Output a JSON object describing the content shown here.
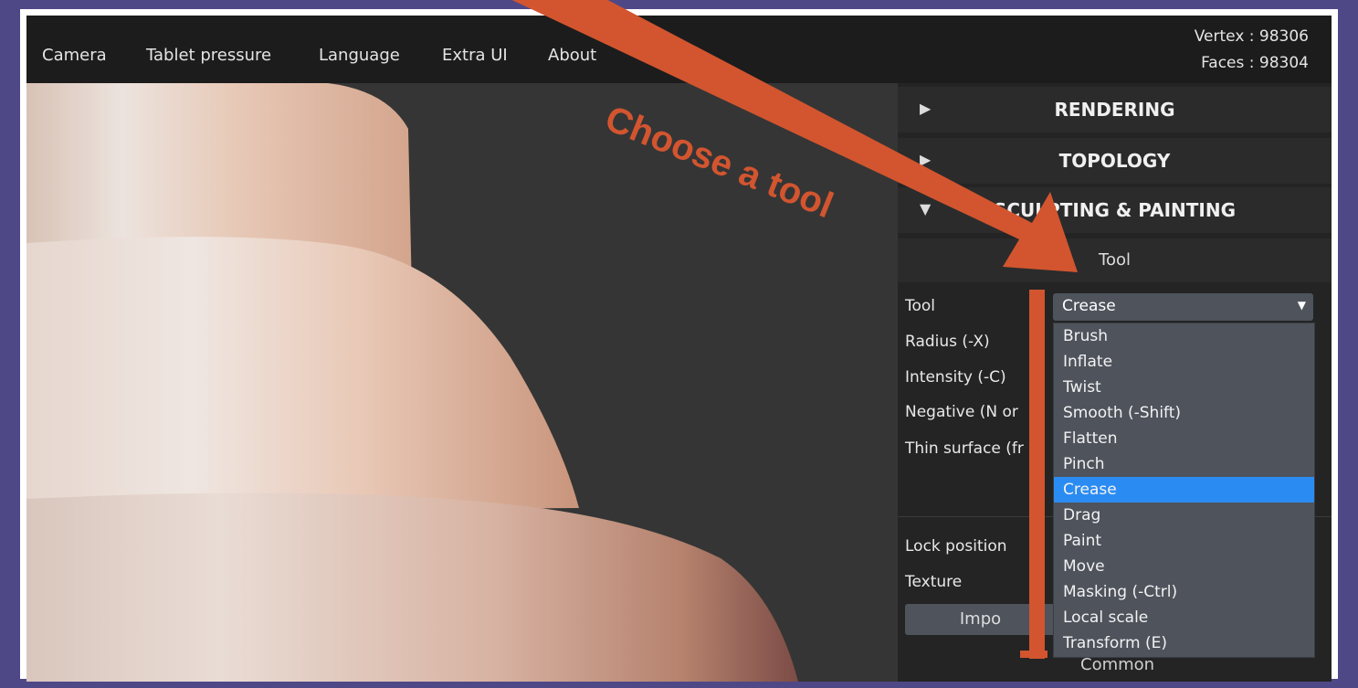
{
  "menu": [
    "Camera",
    "Tablet pressure",
    "Language",
    "Extra UI",
    "About"
  ],
  "stats": {
    "vertex": "Vertex : 98306",
    "faces": "Faces : 98304"
  },
  "panel": {
    "sections": [
      {
        "arrow": "▶",
        "title": "RENDERING"
      },
      {
        "arrow": "▶",
        "title": "TOPOLOGY"
      },
      {
        "arrow": "▼",
        "title": "SCULPTING & PAINTING"
      }
    ],
    "sub_title": "Tool",
    "labels": [
      "Tool",
      "Radius (-X)",
      "Intensity (-C)",
      "Negative (N or",
      "Thin surface (fr",
      "Lock position",
      "Texture"
    ],
    "tool_select": {
      "value": "Crease",
      "caret": "▼"
    },
    "tool_options": [
      "Brush",
      "Inflate",
      "Twist",
      "Smooth (-Shift)",
      "Flatten",
      "Pinch",
      "Crease",
      "Drag",
      "Paint",
      "Move",
      "Masking (-Ctrl)",
      "Local scale",
      "Transform (E)"
    ],
    "selected_option": "Crease",
    "import_button": "Impo",
    "common_label": "Common"
  },
  "annotation": {
    "text": "Choose a tool",
    "color": "#d2552f"
  },
  "colors": {
    "border": "#4f4887",
    "menubar": "#1c1c1c",
    "panel": "#242424",
    "dropdown": "#4e535c",
    "selected": "#2a8cf3"
  }
}
